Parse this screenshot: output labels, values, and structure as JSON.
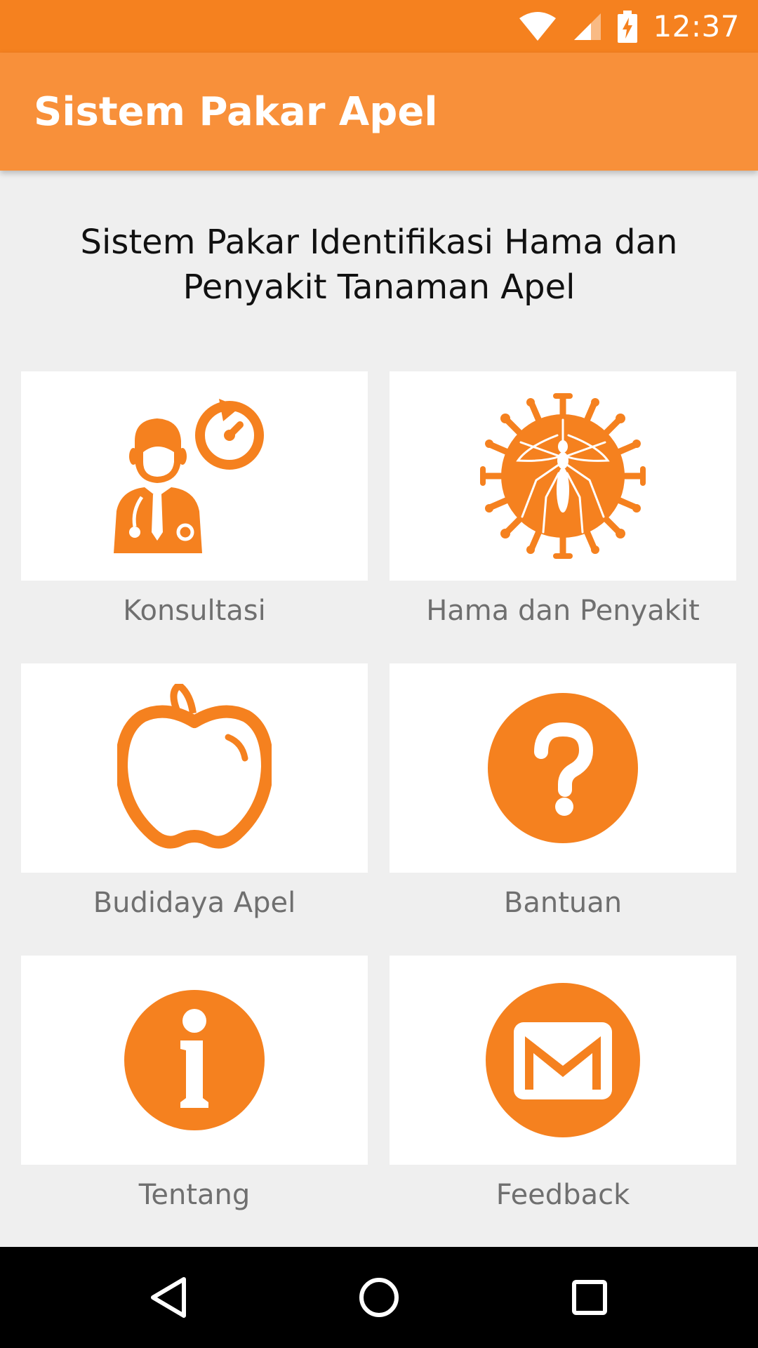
{
  "status_bar": {
    "time": "12:37",
    "icons": [
      "wifi-icon",
      "signal-icon",
      "battery-charging-icon"
    ]
  },
  "app_bar": {
    "title": "Sistem Pakar Apel"
  },
  "main": {
    "headline": "Sistem Pakar Identifikasi Hama dan Penyakit Tanaman Apel",
    "menu": [
      {
        "label": "Konsultasi",
        "icon": "doctor-consultation-icon"
      },
      {
        "label": "Hama dan Penyakit",
        "icon": "mosquito-virus-icon"
      },
      {
        "label": "Budidaya Apel",
        "icon": "apple-icon"
      },
      {
        "label": "Bantuan",
        "icon": "help-icon"
      },
      {
        "label": "Tentang",
        "icon": "info-icon"
      },
      {
        "label": "Feedback",
        "icon": "mail-icon"
      }
    ]
  },
  "nav_bar": {
    "buttons": [
      "back-icon",
      "home-icon",
      "recents-icon"
    ]
  },
  "colors": {
    "status_bar": "#f5811f",
    "app_bar": "#f8903a",
    "accent": "#f5811f",
    "background": "#efefef",
    "card": "#ffffff",
    "label_text": "#6f6f6f"
  }
}
